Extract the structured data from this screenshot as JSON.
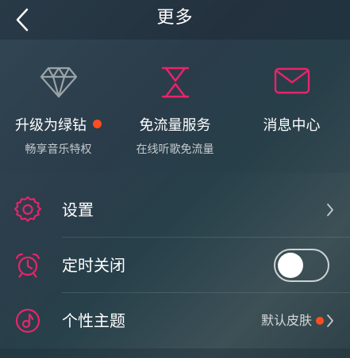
{
  "header": {
    "title": "更多",
    "back_icon": "chevron-left-icon"
  },
  "features": [
    {
      "label": "升级为绿钻",
      "subtitle": "畅享音乐特权",
      "icon": "diamond-icon",
      "has_badge": true
    },
    {
      "label": "免流量服务",
      "subtitle": "在线听歌免流量",
      "icon": "hourglass-icon",
      "has_badge": false
    },
    {
      "label": "消息中心",
      "subtitle": "",
      "icon": "envelope-icon",
      "has_badge": false
    }
  ],
  "menu": [
    {
      "label": "设置",
      "icon": "gear-icon",
      "control": "chevron"
    },
    {
      "label": "定时关闭",
      "icon": "alarm-clock-icon",
      "control": "toggle",
      "toggle_on": false
    },
    {
      "label": "个性主题",
      "icon": "theme-icon",
      "control": "value-chevron",
      "value": "默认皮肤",
      "has_badge": true
    }
  ],
  "colors": {
    "accent": "#e8246b",
    "badge": "#ff4d1f",
    "diamond_icon": "#9aa3a8",
    "text": "#ffffff"
  }
}
